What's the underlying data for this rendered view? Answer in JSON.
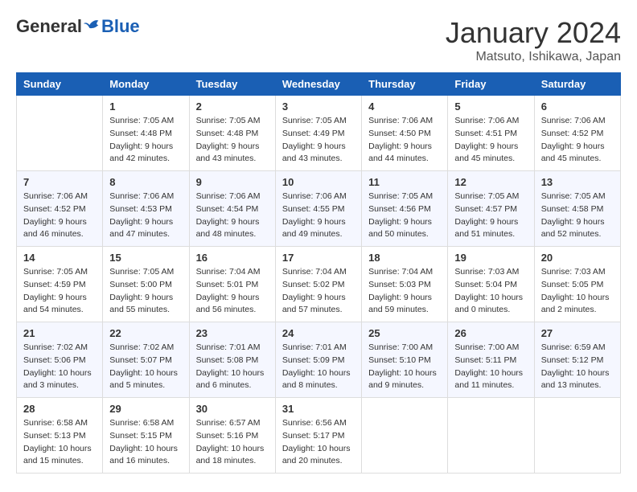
{
  "header": {
    "logo": {
      "general": "General",
      "blue": "Blue"
    },
    "title": "January 2024",
    "subtitle": "Matsuto, Ishikawa, Japan"
  },
  "calendar": {
    "weekdays": [
      "Sunday",
      "Monday",
      "Tuesday",
      "Wednesday",
      "Thursday",
      "Friday",
      "Saturday"
    ],
    "weeks": [
      [
        {
          "day": "",
          "sunrise": "",
          "sunset": "",
          "daylight": ""
        },
        {
          "day": "1",
          "sunrise": "Sunrise: 7:05 AM",
          "sunset": "Sunset: 4:48 PM",
          "daylight": "Daylight: 9 hours and 42 minutes."
        },
        {
          "day": "2",
          "sunrise": "Sunrise: 7:05 AM",
          "sunset": "Sunset: 4:48 PM",
          "daylight": "Daylight: 9 hours and 43 minutes."
        },
        {
          "day": "3",
          "sunrise": "Sunrise: 7:05 AM",
          "sunset": "Sunset: 4:49 PM",
          "daylight": "Daylight: 9 hours and 43 minutes."
        },
        {
          "day": "4",
          "sunrise": "Sunrise: 7:06 AM",
          "sunset": "Sunset: 4:50 PM",
          "daylight": "Daylight: 9 hours and 44 minutes."
        },
        {
          "day": "5",
          "sunrise": "Sunrise: 7:06 AM",
          "sunset": "Sunset: 4:51 PM",
          "daylight": "Daylight: 9 hours and 45 minutes."
        },
        {
          "day": "6",
          "sunrise": "Sunrise: 7:06 AM",
          "sunset": "Sunset: 4:52 PM",
          "daylight": "Daylight: 9 hours and 45 minutes."
        }
      ],
      [
        {
          "day": "7",
          "sunrise": "Sunrise: 7:06 AM",
          "sunset": "Sunset: 4:52 PM",
          "daylight": "Daylight: 9 hours and 46 minutes."
        },
        {
          "day": "8",
          "sunrise": "Sunrise: 7:06 AM",
          "sunset": "Sunset: 4:53 PM",
          "daylight": "Daylight: 9 hours and 47 minutes."
        },
        {
          "day": "9",
          "sunrise": "Sunrise: 7:06 AM",
          "sunset": "Sunset: 4:54 PM",
          "daylight": "Daylight: 9 hours and 48 minutes."
        },
        {
          "day": "10",
          "sunrise": "Sunrise: 7:06 AM",
          "sunset": "Sunset: 4:55 PM",
          "daylight": "Daylight: 9 hours and 49 minutes."
        },
        {
          "day": "11",
          "sunrise": "Sunrise: 7:05 AM",
          "sunset": "Sunset: 4:56 PM",
          "daylight": "Daylight: 9 hours and 50 minutes."
        },
        {
          "day": "12",
          "sunrise": "Sunrise: 7:05 AM",
          "sunset": "Sunset: 4:57 PM",
          "daylight": "Daylight: 9 hours and 51 minutes."
        },
        {
          "day": "13",
          "sunrise": "Sunrise: 7:05 AM",
          "sunset": "Sunset: 4:58 PM",
          "daylight": "Daylight: 9 hours and 52 minutes."
        }
      ],
      [
        {
          "day": "14",
          "sunrise": "Sunrise: 7:05 AM",
          "sunset": "Sunset: 4:59 PM",
          "daylight": "Daylight: 9 hours and 54 minutes."
        },
        {
          "day": "15",
          "sunrise": "Sunrise: 7:05 AM",
          "sunset": "Sunset: 5:00 PM",
          "daylight": "Daylight: 9 hours and 55 minutes."
        },
        {
          "day": "16",
          "sunrise": "Sunrise: 7:04 AM",
          "sunset": "Sunset: 5:01 PM",
          "daylight": "Daylight: 9 hours and 56 minutes."
        },
        {
          "day": "17",
          "sunrise": "Sunrise: 7:04 AM",
          "sunset": "Sunset: 5:02 PM",
          "daylight": "Daylight: 9 hours and 57 minutes."
        },
        {
          "day": "18",
          "sunrise": "Sunrise: 7:04 AM",
          "sunset": "Sunset: 5:03 PM",
          "daylight": "Daylight: 9 hours and 59 minutes."
        },
        {
          "day": "19",
          "sunrise": "Sunrise: 7:03 AM",
          "sunset": "Sunset: 5:04 PM",
          "daylight": "Daylight: 10 hours and 0 minutes."
        },
        {
          "day": "20",
          "sunrise": "Sunrise: 7:03 AM",
          "sunset": "Sunset: 5:05 PM",
          "daylight": "Daylight: 10 hours and 2 minutes."
        }
      ],
      [
        {
          "day": "21",
          "sunrise": "Sunrise: 7:02 AM",
          "sunset": "Sunset: 5:06 PM",
          "daylight": "Daylight: 10 hours and 3 minutes."
        },
        {
          "day": "22",
          "sunrise": "Sunrise: 7:02 AM",
          "sunset": "Sunset: 5:07 PM",
          "daylight": "Daylight: 10 hours and 5 minutes."
        },
        {
          "day": "23",
          "sunrise": "Sunrise: 7:01 AM",
          "sunset": "Sunset: 5:08 PM",
          "daylight": "Daylight: 10 hours and 6 minutes."
        },
        {
          "day": "24",
          "sunrise": "Sunrise: 7:01 AM",
          "sunset": "Sunset: 5:09 PM",
          "daylight": "Daylight: 10 hours and 8 minutes."
        },
        {
          "day": "25",
          "sunrise": "Sunrise: 7:00 AM",
          "sunset": "Sunset: 5:10 PM",
          "daylight": "Daylight: 10 hours and 9 minutes."
        },
        {
          "day": "26",
          "sunrise": "Sunrise: 7:00 AM",
          "sunset": "Sunset: 5:11 PM",
          "daylight": "Daylight: 10 hours and 11 minutes."
        },
        {
          "day": "27",
          "sunrise": "Sunrise: 6:59 AM",
          "sunset": "Sunset: 5:12 PM",
          "daylight": "Daylight: 10 hours and 13 minutes."
        }
      ],
      [
        {
          "day": "28",
          "sunrise": "Sunrise: 6:58 AM",
          "sunset": "Sunset: 5:13 PM",
          "daylight": "Daylight: 10 hours and 15 minutes."
        },
        {
          "day": "29",
          "sunrise": "Sunrise: 6:58 AM",
          "sunset": "Sunset: 5:15 PM",
          "daylight": "Daylight: 10 hours and 16 minutes."
        },
        {
          "day": "30",
          "sunrise": "Sunrise: 6:57 AM",
          "sunset": "Sunset: 5:16 PM",
          "daylight": "Daylight: 10 hours and 18 minutes."
        },
        {
          "day": "31",
          "sunrise": "Sunrise: 6:56 AM",
          "sunset": "Sunset: 5:17 PM",
          "daylight": "Daylight: 10 hours and 20 minutes."
        },
        {
          "day": "",
          "sunrise": "",
          "sunset": "",
          "daylight": ""
        },
        {
          "day": "",
          "sunrise": "",
          "sunset": "",
          "daylight": ""
        },
        {
          "day": "",
          "sunrise": "",
          "sunset": "",
          "daylight": ""
        }
      ]
    ]
  }
}
